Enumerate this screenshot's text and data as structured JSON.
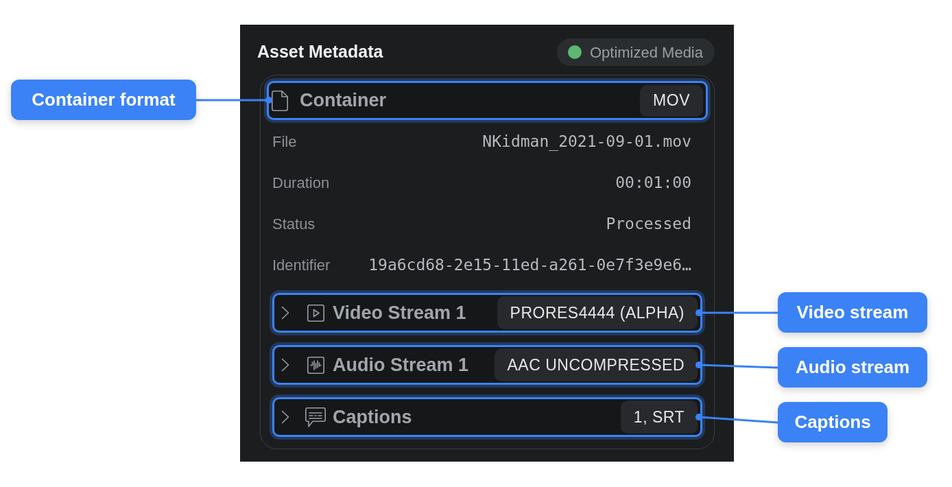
{
  "panel": {
    "title": "Asset Metadata",
    "badge": {
      "label": "Optimized Media",
      "color": "#5cb772"
    }
  },
  "container": {
    "kind": "container",
    "title": "Container",
    "tag": "MOV",
    "highlighted": true,
    "fields": [
      {
        "label": "File",
        "value": "NKidman_2021-09-01.mov"
      },
      {
        "label": "Duration",
        "value": "00:01:00"
      },
      {
        "label": "Status",
        "value": "Processed"
      },
      {
        "label": "Identifier",
        "value": "19a6cd68-2e15-11ed-a261-0e7f3e9e6…"
      }
    ]
  },
  "streams": [
    {
      "kind": "video",
      "title": "Video Stream 1",
      "tag": "PRORES4444 (ALPHA)",
      "expanded": false,
      "highlighted": true
    },
    {
      "kind": "audio",
      "title": "Audio Stream 1",
      "tag": "AAC UNCOMPRESSED",
      "expanded": false,
      "highlighted": true
    },
    {
      "kind": "captions",
      "title": "Captions",
      "tag": "1, SRT",
      "expanded": false,
      "highlighted": true
    }
  ],
  "callouts": [
    {
      "label": "Container format"
    },
    {
      "label": "Video stream"
    },
    {
      "label": "Audio stream"
    },
    {
      "label": "Captions"
    }
  ]
}
